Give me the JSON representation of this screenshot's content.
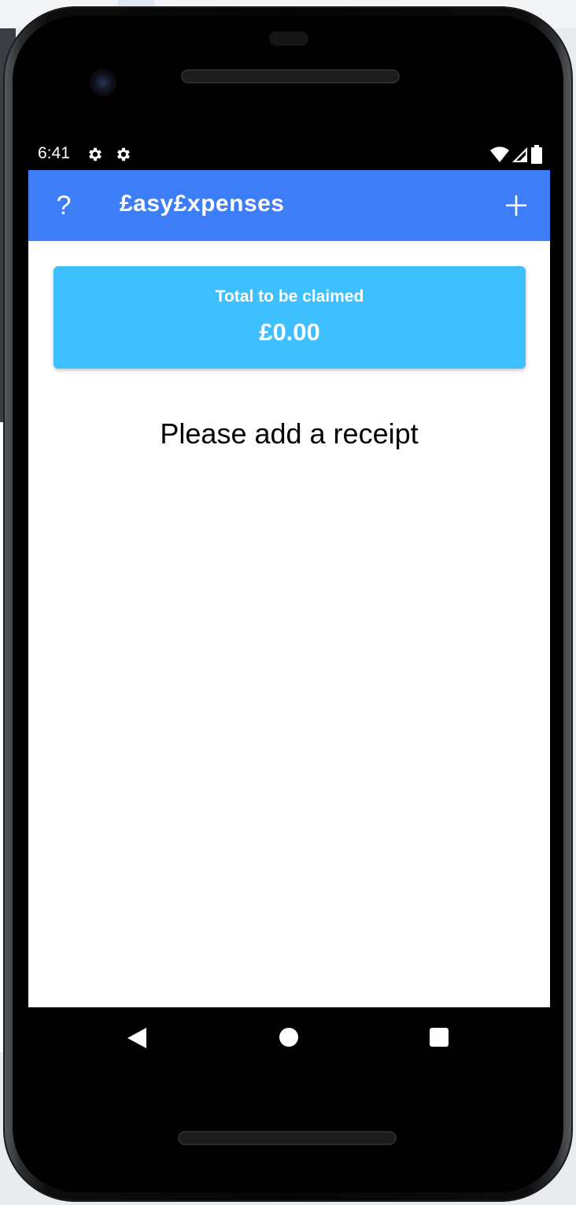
{
  "status_bar": {
    "time": "6:41",
    "left_icons": [
      "gear-icon",
      "gear-icon"
    ],
    "right_icons": [
      "wifi-icon",
      "signal-icon",
      "battery-icon"
    ]
  },
  "app_bar": {
    "title": "£asy£xpenses",
    "help_label": "?",
    "add_icon": "plus-icon",
    "color": "#3d7ef8"
  },
  "summary_card": {
    "label": "Total to be claimed",
    "amount": "£0.00",
    "color": "#3ebffe"
  },
  "empty_state": {
    "message": "Please add a receipt"
  },
  "nav_bar": {
    "icons": [
      "back-icon",
      "home-icon",
      "recents-icon"
    ]
  }
}
